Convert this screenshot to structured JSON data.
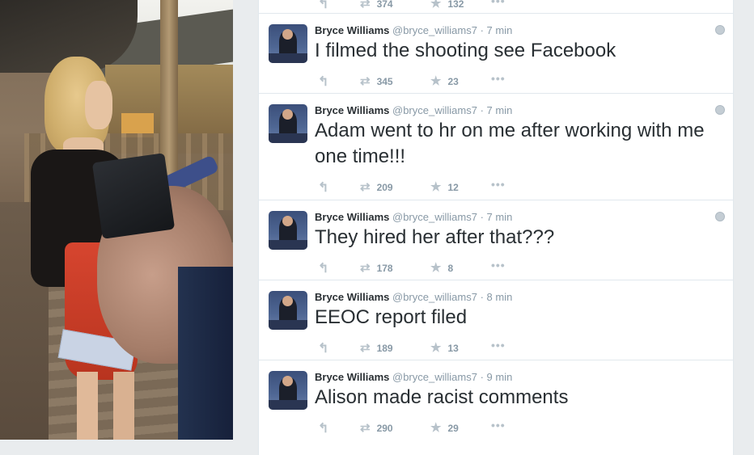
{
  "partial_tweet": {
    "retweets": "374",
    "favorites": "132"
  },
  "tweets": [
    {
      "name": "Bryce Williams",
      "handle": "@bryce_williams7",
      "sep": "·",
      "time": "7 min",
      "text": "I filmed the shooting see Facebook",
      "retweets": "345",
      "favorites": "23"
    },
    {
      "name": "Bryce Williams",
      "handle": "@bryce_williams7",
      "sep": "·",
      "time": "7 min",
      "text": "Adam went to hr on me after working with me one time!!!",
      "retweets": "209",
      "favorites": "12"
    },
    {
      "name": "Bryce Williams",
      "handle": "@bryce_williams7",
      "sep": "·",
      "time": "7 min",
      "text": "They hired her after that???",
      "retweets": "178",
      "favorites": "8"
    },
    {
      "name": "Bryce Williams",
      "handle": "@bryce_williams7",
      "sep": "·",
      "time": "8 min",
      "text": "EEOC report filed",
      "retweets": "189",
      "favorites": "13"
    },
    {
      "name": "Bryce Williams",
      "handle": "@bryce_williams7",
      "sep": "·",
      "time": "9 min",
      "text": "Alison made racist comments",
      "retweets": "290",
      "favorites": "29"
    }
  ],
  "icons": {
    "reply": "reply-icon",
    "retweet": "retweet-icon",
    "favorite": "star-icon",
    "more": "more-icon",
    "globe": "globe-icon"
  },
  "colors": {
    "name": "#292f33",
    "meta": "#8899a6",
    "icon": "#b7c2ca",
    "divider": "#e1e8ed"
  }
}
